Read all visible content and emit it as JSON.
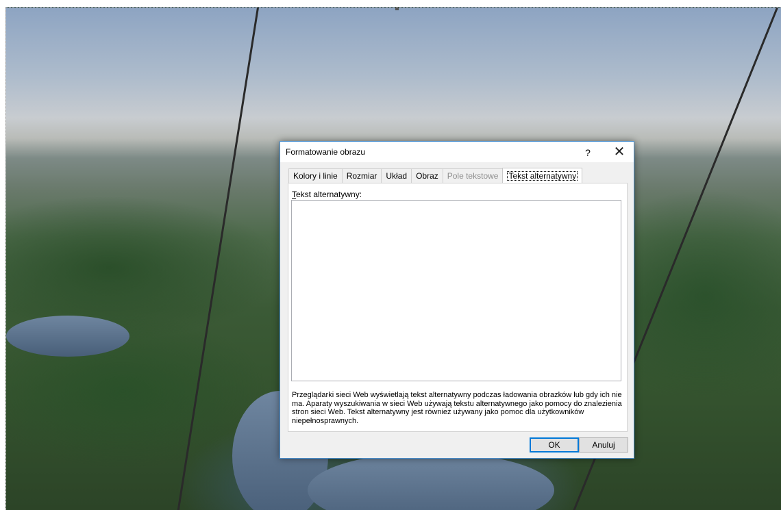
{
  "dialog": {
    "title": "Formatowanie obrazu",
    "help_label": "?",
    "close_label": "✕",
    "tabs": [
      {
        "label": "Kolory i linie",
        "state": "normal"
      },
      {
        "label": "Rozmiar",
        "state": "normal"
      },
      {
        "label": "Układ",
        "state": "normal"
      },
      {
        "label": "Obraz",
        "state": "normal"
      },
      {
        "label": "Pole tekstowe",
        "state": "disabled"
      },
      {
        "label": "Tekst alternatywny",
        "state": "active"
      }
    ],
    "alt_text": {
      "label_accel": "T",
      "label_rest": "ekst alternatywny:",
      "value": ""
    },
    "help_text": "Przeglądarki sieci Web wyświetlają tekst alternatywny podczas ładowania obrazków lub gdy ich nie ma. Aparaty wyszukiwania w sieci Web używają tekstu alternatywnego jako pomocy do znalezienia stron sieci Web. Tekst alternatywny jest również używany jako pomoc dla użytkowników niepełnosprawnych.",
    "ok_label": "OK",
    "cancel_label": "Anuluj"
  },
  "colors": {
    "dialog_border": "#4a90d0",
    "default_button_border": "#0078d7"
  }
}
